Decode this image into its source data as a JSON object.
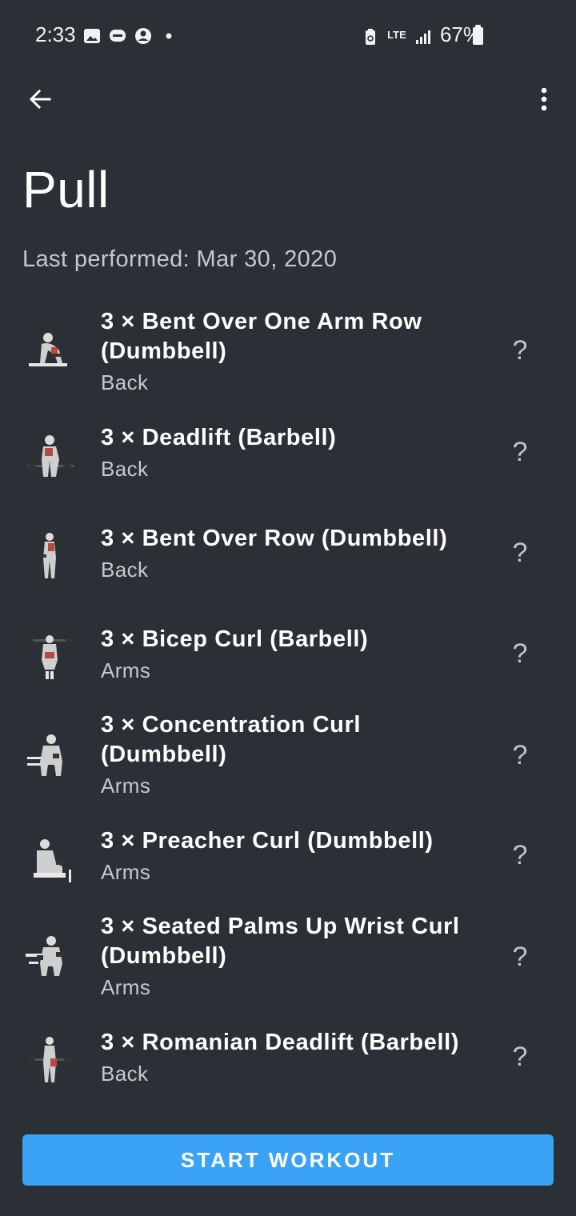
{
  "status_bar": {
    "time": "2:33",
    "network": "LTE",
    "battery": "67%",
    "left_icons": [
      "image-icon",
      "chat-bubble-icon",
      "account-circle-icon",
      "dot-icon"
    ],
    "right_icons": [
      "battery-saver-icon",
      "lte-icon",
      "signal-icon",
      "battery-icon"
    ]
  },
  "app_bar": {
    "back_icon": "arrow-left-icon",
    "menu_icon": "more-vert-icon"
  },
  "routine": {
    "title": "Pull",
    "last_performed": "Last performed: Mar 30, 2020"
  },
  "exercises": [
    {
      "name": "3 × Bent Over One Arm Row (Dumbbell)",
      "muscle": "Back",
      "help": "?"
    },
    {
      "name": "3 × Deadlift (Barbell)",
      "muscle": "Back",
      "help": "?"
    },
    {
      "name": "3 × Bent Over Row (Dumbbell)",
      "muscle": "Back",
      "help": "?"
    },
    {
      "name": "3 × Bicep Curl (Barbell)",
      "muscle": "Arms",
      "help": "?"
    },
    {
      "name": "3 × Concentration Curl (Dumbbell)",
      "muscle": "Arms",
      "help": "?"
    },
    {
      "name": "3 × Preacher Curl (Dumbbell)",
      "muscle": "Arms",
      "help": "?"
    },
    {
      "name": "3 × Seated Palms Up Wrist Curl (Dumbbell)",
      "muscle": "Arms",
      "help": "?"
    },
    {
      "name": "3 × Romanian Deadlift (Barbell)",
      "muscle": "Back",
      "help": "?"
    }
  ],
  "actions": {
    "start_workout": "START WORKOUT"
  },
  "colors": {
    "background": "#2b3036",
    "accent": "#3aa3f5",
    "secondary_text": "#c5c9ce"
  }
}
